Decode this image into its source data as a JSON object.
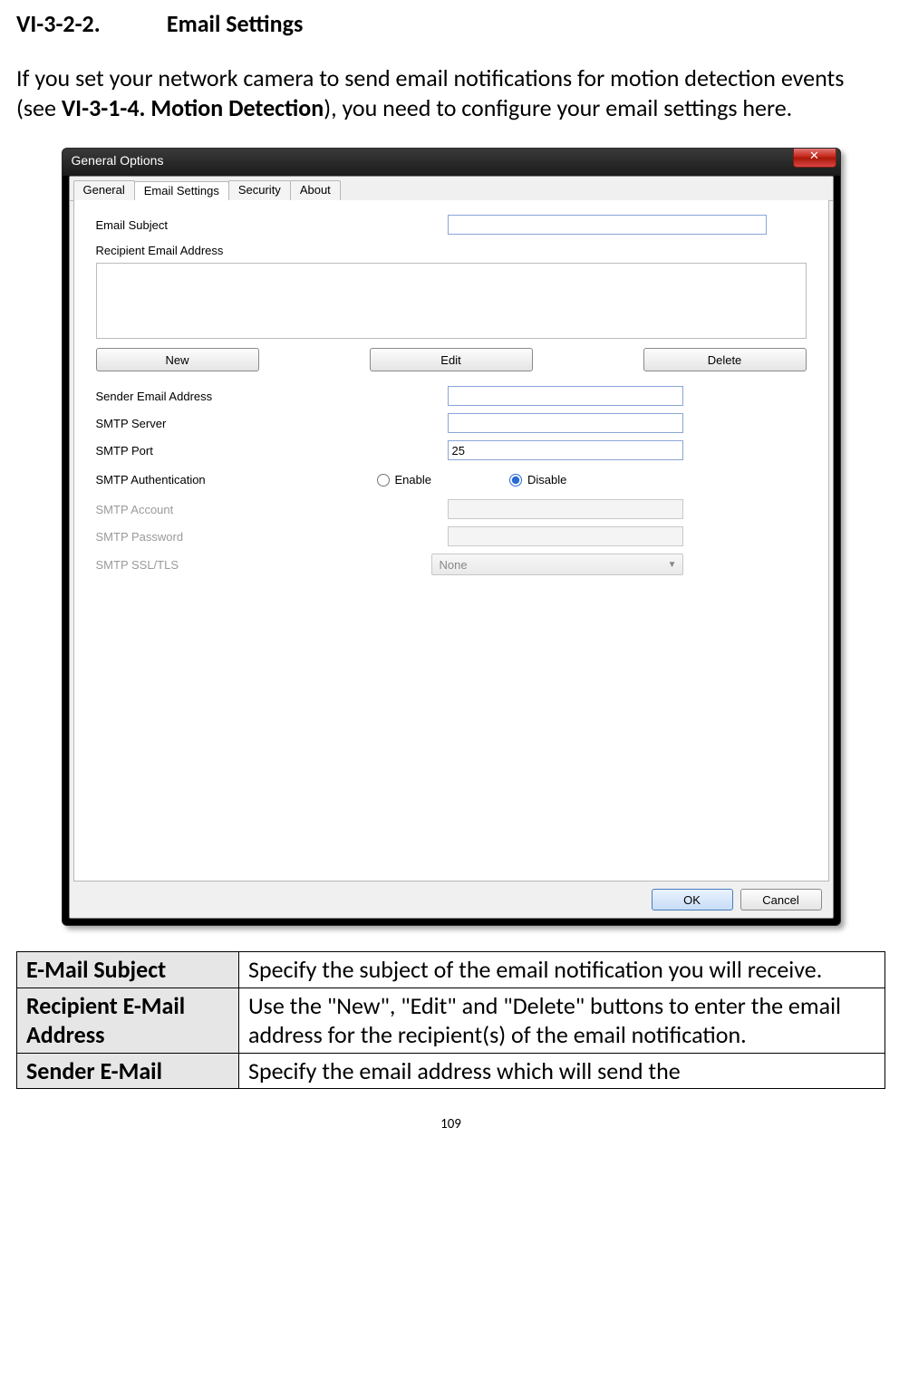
{
  "heading": {
    "num": "VI-3-2-2.",
    "title": "Email Settings"
  },
  "intro": {
    "pre": "If you set your network camera to send email notifications for motion detection events (see ",
    "bold": "VI-3-1-4. Motion Detection",
    "post": "), you need to configure your email settings here."
  },
  "dialog": {
    "title": "General Options",
    "close_glyph": "✕",
    "tabs": {
      "general": "General",
      "email": "Email Settings",
      "security": "Security",
      "about": "About"
    },
    "labels": {
      "email_subject": "Email Subject",
      "recipient": "Recipient Email Address",
      "sender": "Sender Email Address",
      "smtp_server": "SMTP Server",
      "smtp_port": "SMTP Port",
      "smtp_auth": "SMTP Authentication",
      "smtp_account": "SMTP Account",
      "smtp_password": "SMTP Password",
      "smtp_ssl": "SMTP SSL/TLS"
    },
    "values": {
      "email_subject": "",
      "sender": "",
      "smtp_server": "",
      "smtp_port": "25",
      "smtp_account": "",
      "smtp_password": "",
      "smtp_ssl": "None"
    },
    "buttons": {
      "new": "New",
      "edit": "Edit",
      "delete": "Delete",
      "ok": "OK",
      "cancel": "Cancel"
    },
    "radio": {
      "enable": "Enable",
      "disable": "Disable",
      "selected": "disable"
    }
  },
  "table": {
    "rows": [
      {
        "k": "E-Mail Subject",
        "v": "Specify the subject of the email notification you will receive."
      },
      {
        "k": "Recipient E-Mail Address",
        "v": "Use the \"New\", \"Edit\" and \"Delete\" buttons to enter the email address for the recipient(s) of the email notification."
      },
      {
        "k": "Sender E-Mail",
        "v": "Specify the email address which will send the"
      }
    ]
  },
  "page_number": "109"
}
